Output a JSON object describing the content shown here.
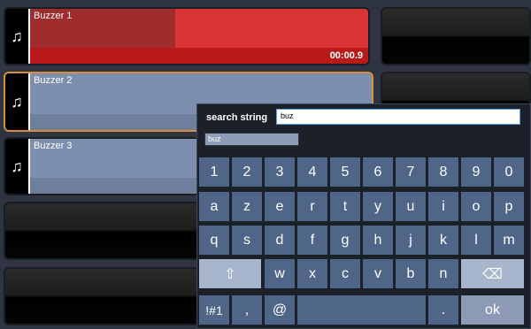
{
  "tiles": [
    {
      "title": "Buzzer 1",
      "time": "00:00.9",
      "icon": "music-note-icon"
    },
    {
      "title": "Buzzer 2",
      "icon": "music-note-icon"
    },
    {
      "title": "Buzzer 3",
      "icon": "music-note-icon"
    }
  ],
  "keyboard": {
    "search_label": "search string",
    "search_value": "buz",
    "suggestion": "buz",
    "rows": [
      [
        "1",
        "2",
        "3",
        "4",
        "5",
        "6",
        "7",
        "8",
        "9",
        "0"
      ],
      [
        "a",
        "z",
        "e",
        "r",
        "t",
        "y",
        "u",
        "i",
        "o",
        "p"
      ],
      [
        "q",
        "s",
        "d",
        "f",
        "g",
        "h",
        "j",
        "k",
        "l",
        "m"
      ],
      [
        "w",
        "x",
        "c",
        "v",
        "b",
        "n"
      ]
    ],
    "shift_glyph": "⇧",
    "backspace_glyph": "⌫",
    "symbols_label": "!#1",
    "comma": ",",
    "at": "@",
    "period": ".",
    "ok_label": "ok"
  },
  "colors": {
    "playing_red": "#d93535",
    "tile_blue": "#7d8fae",
    "selected_border": "#d7913a"
  }
}
